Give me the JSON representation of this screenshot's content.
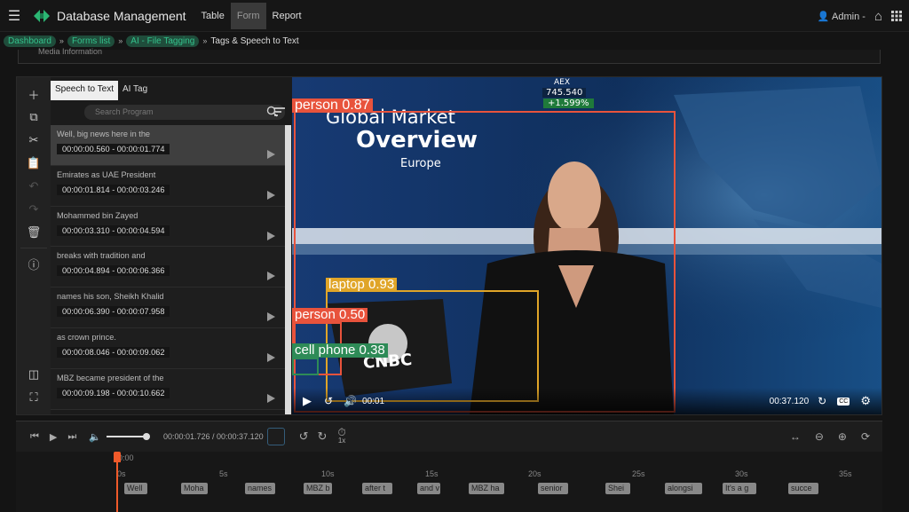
{
  "app": {
    "title": "Database Management"
  },
  "nav": {
    "tabs": [
      "Table",
      "Form",
      "Report"
    ],
    "active": "Form"
  },
  "user": {
    "name": "Admin -"
  },
  "breadcrumbs": {
    "items": [
      "Dashboard",
      "Forms list",
      "AI - File Tagging"
    ],
    "current": "Tags & Speech to Text"
  },
  "section": {
    "title": "Media Information"
  },
  "panel": {
    "tabs": [
      "Speech to Text",
      "AI Tag"
    ],
    "active_tab": "Speech to Text",
    "search_placeholder": "Search Program"
  },
  "transcript": [
    {
      "text": "Well, big news here in the",
      "time": "00:00:00.560 - 00:00:01.774",
      "selected": true
    },
    {
      "text": "Emirates as UAE President",
      "time": "00:00:01.814 - 00:00:03.246"
    },
    {
      "text": "Mohammed bin Zayed",
      "time": "00:00:03.310 - 00:00:04.594"
    },
    {
      "text": "breaks with tradition and",
      "time": "00:00:04.894 - 00:00:06.366"
    },
    {
      "text": "names his son, Sheikh Khalid",
      "time": "00:00:06.390 - 00:00:07.958"
    },
    {
      "text": "as crown prince.",
      "time": "00:00:08.046 - 00:00:09.062"
    },
    {
      "text": "MBZ became president of the",
      "time": "00:00:09.198 - 00:00:10.662"
    }
  ],
  "video": {
    "current_time": "00:01",
    "duration": "00:37.120",
    "scene": {
      "headline1": "Global Market",
      "headline2": "Overview",
      "subline": "Europe",
      "ticker_name": "AEX",
      "ticker_value": "745.540",
      "ticker_change": "+1.599%",
      "brand": "CNBC"
    },
    "detections": [
      {
        "label": "person 0.87",
        "color": "#e8533c"
      },
      {
        "label": "laptop 0.93",
        "color": "#e0a528"
      },
      {
        "label": "person 0.50",
        "color": "#e8533c"
      },
      {
        "label": "cell phone 0.38",
        "color": "#2e8b57"
      }
    ]
  },
  "timeline": {
    "position": "00:00:01.726 / 00:00:37.120",
    "speed": "1x",
    "playhead_label": "0:00",
    "ticks": [
      "0s",
      "5s",
      "10s",
      "15s",
      "20s",
      "25s",
      "30s",
      "35s"
    ],
    "clips": [
      "Well",
      "Moha",
      "names",
      "MBZ b",
      "after t",
      "and v",
      "MBZ ha",
      "senior",
      "Shei",
      "alongsi",
      "It's a g",
      "succe"
    ]
  }
}
